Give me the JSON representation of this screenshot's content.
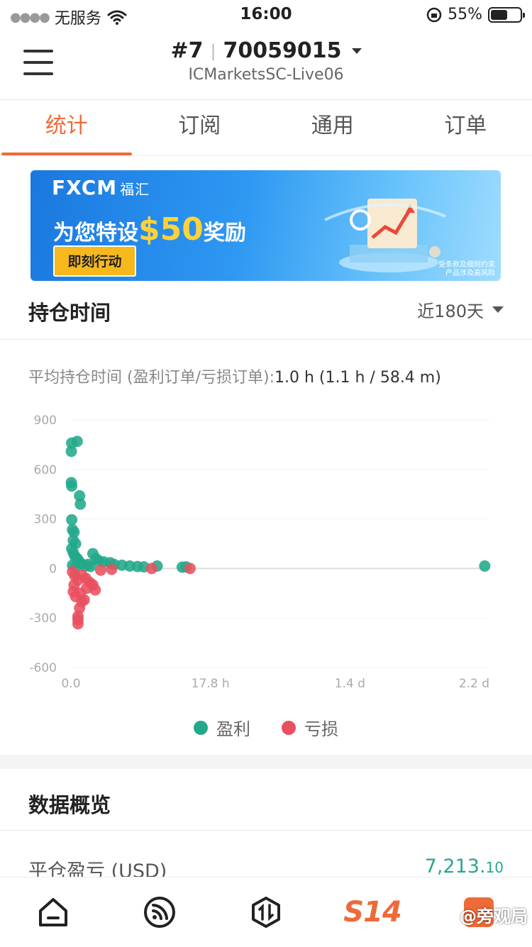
{
  "status": {
    "carrier": "无服务",
    "time": "16:00",
    "battery": "55%"
  },
  "header": {
    "account_num": "#7",
    "account_id": "70059015",
    "server": "ICMarketsSC-Live06"
  },
  "tabs": [
    {
      "label": "统计",
      "active": true
    },
    {
      "label": "订阅",
      "active": false
    },
    {
      "label": "通用",
      "active": false
    },
    {
      "label": "订单",
      "active": false
    }
  ],
  "banner": {
    "brand": "FXCM",
    "brand_cn": "福汇",
    "promo_prefix": "为您特设",
    "promo_amount": "$50",
    "promo_suffix": "奖励",
    "cta": "即刻行动",
    "disclaimer1": "受条款及细则约束",
    "disclaimer2": "产品涉及高风险"
  },
  "holding": {
    "title": "持仓时间",
    "period": "近180天",
    "avg_label": "平均持仓时间 (盈利订单/亏损订单):",
    "avg_value": "1.0 h (1.1 h / 58.4 m)"
  },
  "chart_data": {
    "type": "scatter",
    "y_ticks": [
      "900",
      "600",
      "300",
      "0",
      "-300",
      "-600"
    ],
    "x_ticks": [
      "0.0",
      "17.8 h",
      "1.4 d",
      "2.2 d"
    ],
    "x_unit": "hours",
    "x_tick_values": [
      0,
      17.8,
      35.6,
      53.4
    ],
    "ylim": [
      -600,
      900
    ],
    "xlim": [
      0,
      53.4
    ],
    "colors": {
      "profit": "#22a98a",
      "loss": "#e8505e"
    },
    "series": [
      {
        "name": "盈利",
        "points": [
          [
            0.1,
            760
          ],
          [
            0.8,
            770
          ],
          [
            0.05,
            710
          ],
          [
            0.05,
            520
          ],
          [
            0.1,
            500
          ],
          [
            1.1,
            440
          ],
          [
            1.2,
            390
          ],
          [
            0.1,
            295
          ],
          [
            0.2,
            235
          ],
          [
            0.4,
            220
          ],
          [
            0.3,
            170
          ],
          [
            0.6,
            150
          ],
          [
            0.1,
            120
          ],
          [
            0.3,
            95
          ],
          [
            0.5,
            75
          ],
          [
            0.8,
            60
          ],
          [
            1,
            45
          ],
          [
            1.3,
            30
          ],
          [
            2.2,
            25
          ],
          [
            2.8,
            90
          ],
          [
            3.2,
            60
          ],
          [
            3.6,
            45
          ],
          [
            4.2,
            40
          ],
          [
            5,
            35
          ],
          [
            5.5,
            25
          ],
          [
            6.5,
            20
          ],
          [
            7.5,
            15
          ],
          [
            8.5,
            12
          ],
          [
            9.3,
            10
          ],
          [
            11,
            15
          ],
          [
            14.2,
            8
          ],
          [
            14.7,
            10
          ],
          [
            52.8,
            15
          ],
          [
            0.2,
            20
          ],
          [
            0.6,
            10
          ],
          [
            1.8,
            15
          ],
          [
            2.5,
            12
          ]
        ]
      },
      {
        "name": "亏损",
        "points": [
          [
            0.2,
            -20
          ],
          [
            0.5,
            -45
          ],
          [
            0.9,
            -70
          ],
          [
            1.4,
            -40
          ],
          [
            1.9,
            -60
          ],
          [
            2.4,
            -85
          ],
          [
            2.8,
            -100
          ],
          [
            3.1,
            -130
          ],
          [
            0.3,
            -140
          ],
          [
            0.6,
            -170
          ],
          [
            1.4,
            -200
          ],
          [
            1.7,
            -190
          ],
          [
            1.1,
            -240
          ],
          [
            0.9,
            -290
          ],
          [
            0.9,
            -310
          ],
          [
            0.9,
            -335
          ],
          [
            3.8,
            -10
          ],
          [
            5.2,
            -5
          ],
          [
            10.3,
            0
          ],
          [
            15.2,
            0
          ],
          [
            0.4,
            -100
          ],
          [
            2,
            -120
          ],
          [
            1.2,
            -150
          ]
        ]
      }
    ]
  },
  "overview": {
    "title": "数据概览",
    "row_label": "平仓盈亏 (USD)",
    "row_value_main": "7,213.",
    "row_value_dec": "10"
  },
  "watermark": "@旁观局"
}
